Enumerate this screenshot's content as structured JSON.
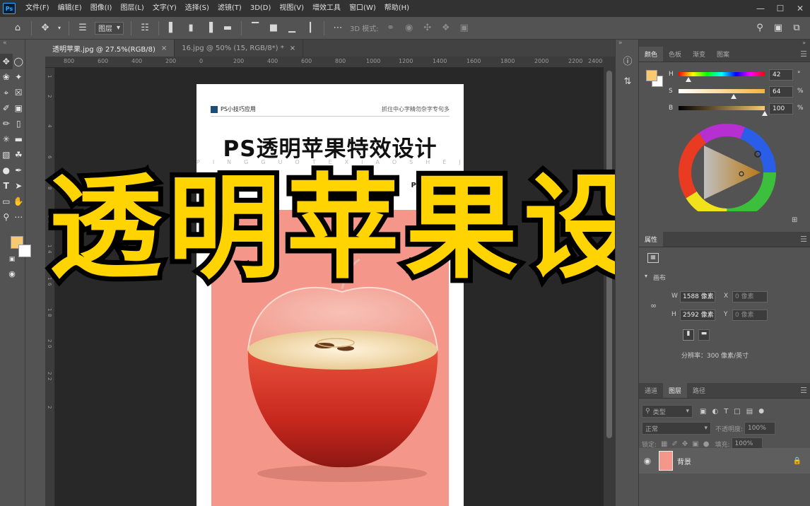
{
  "app": {
    "logo": "Ps"
  },
  "menu": [
    "文件(F)",
    "编辑(E)",
    "图像(I)",
    "图层(L)",
    "文字(Y)",
    "选择(S)",
    "滤镜(T)",
    "3D(D)",
    "视图(V)",
    "增效工具",
    "窗口(W)",
    "帮助(H)"
  ],
  "options_bar": {
    "layer_select": "图层",
    "mode_3d_label": "3D 模式:"
  },
  "doc_tabs": [
    {
      "label": "透明苹果.jpg @ 27.5%(RGB/8)"
    },
    {
      "label": "16.jpg @ 50% (15, RGB/8*) *"
    }
  ],
  "ruler_top": [
    "800",
    "600",
    "400",
    "200",
    "0",
    "200",
    "400",
    "600",
    "800",
    "1000",
    "1200",
    "1400",
    "1600",
    "1800",
    "2000",
    "2200",
    "2400"
  ],
  "ruler_left": [
    "1",
    "2",
    "4",
    "6",
    "8",
    "1",
    "0",
    "1",
    "4",
    "1",
    "6",
    "1",
    "8",
    "2",
    "0",
    "2",
    "2",
    "2"
  ],
  "document": {
    "brand": "PS小技巧应用",
    "slogan": "抓住中心字精勿杂字专句多",
    "title": "PS透明苹果特效设计",
    "pinyin": "PINGGUOTEXIAOSHEJI",
    "ps_mark": "PS"
  },
  "overlay_title": "透明苹果设计",
  "color_panel": {
    "tabs": [
      "颜色",
      "色板",
      "渐变",
      "图案"
    ],
    "h": {
      "label": "H",
      "value": "42",
      "unit": "°"
    },
    "s": {
      "label": "S",
      "value": "64",
      "unit": "%"
    },
    "b": {
      "label": "B",
      "value": "100",
      "unit": "%"
    },
    "foreground": "#f7c971",
    "background": "#ffffff"
  },
  "properties_panel": {
    "title": "属性",
    "section_label": "画布",
    "w_label": "W",
    "w_value": "1588 像素",
    "h_label": "H",
    "h_value": "2592 像素",
    "x_label": "X",
    "x_value": "0 像素",
    "y_label": "Y",
    "y_value": "0 像素",
    "resolution": "分辨率：300 像素/英寸"
  },
  "layers_panel": {
    "tabs": [
      "通道",
      "图层",
      "路径"
    ],
    "filter_kind": "类型",
    "blend_mode": "正常",
    "opacity_label": "不透明度:",
    "opacity_value": "100%",
    "lock_label": "锁定:",
    "fill_label": "填充:",
    "fill_value": "100%",
    "layer_name": "背景"
  }
}
